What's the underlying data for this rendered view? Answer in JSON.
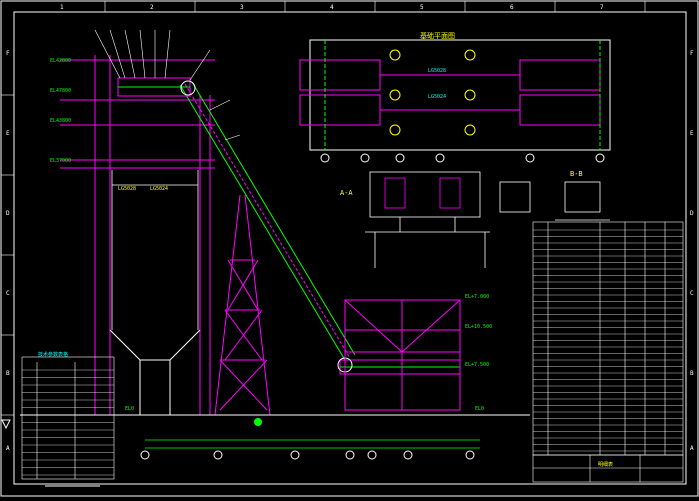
{
  "colors": {
    "background": "#000000",
    "frame": "#ffffff",
    "structure": "#ff00ff",
    "conveyor": "#00ff00",
    "dimension": "#00ff00",
    "annotation": "#ffff00",
    "text": "#ffffff",
    "cyan": "#00ffff",
    "red": "#ff0000"
  },
  "border": {
    "top_letters": [
      "1",
      "2",
      "3",
      "4",
      "5",
      "6",
      "7",
      "8"
    ],
    "side_letters": [
      "F",
      "E",
      "D",
      "C",
      "B",
      "A"
    ]
  },
  "plan_view": {
    "title": "基础平面图",
    "labels": [
      "LG5028",
      "LG5024"
    ]
  },
  "section_view": {
    "title": "A-A",
    "title_b": "B-B"
  },
  "elevations": [
    "EL42800",
    "EL47800",
    "EL43800",
    "EL37000",
    "EL+7.000",
    "EL+10.500",
    "EL+7.500",
    "EL0"
  ],
  "left_table": {
    "title": "技术参数表格"
  },
  "parts_table": {
    "title": "明细表"
  }
}
